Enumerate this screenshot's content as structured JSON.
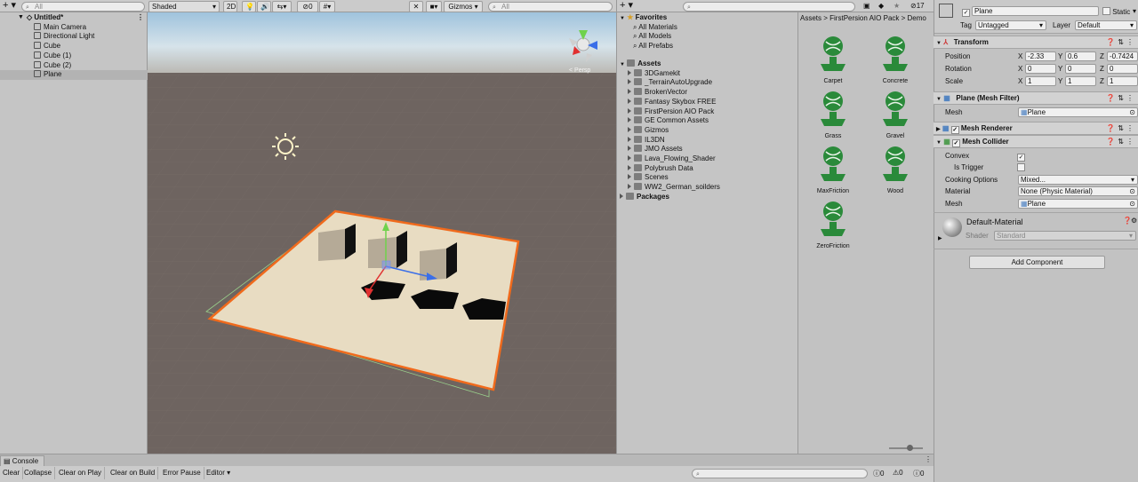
{
  "hierarchy": {
    "search_placeholder": "All",
    "scene": "Untitled*",
    "items": [
      "Main Camera",
      "Directional Light",
      "Cube",
      "Cube (1)",
      "Cube (2)",
      "Plane"
    ]
  },
  "scene_toolbar": {
    "shading": "Shaded",
    "mode_2d": "2D",
    "hidden_count": "0",
    "gizmos": "Gizmos",
    "search_placeholder": "All",
    "persp": "< Persp"
  },
  "project": {
    "favorites": "Favorites",
    "fav_items": [
      "All Materials",
      "All Models",
      "All Prefabs"
    ],
    "assets": "Assets",
    "folders": [
      "3DGamekit",
      "_TerrainAutoUpgrade",
      "BrokenVector",
      "Fantasy Skybox FREE",
      "FirstPersion AIO Pack",
      "GE Common Assets",
      "Gizmos",
      "IL3DN",
      "JMO Assets",
      "Lava_Flowing_Shader",
      "Polybrush Data",
      "Scenes",
      "WW2_German_soilders"
    ],
    "packages": "Packages",
    "hidden_count": "17",
    "breadcrumb": [
      "Assets",
      "FirstPersion AIO Pack",
      "Demo"
    ],
    "grid_assets": [
      "Carpet",
      "Concrete",
      "Grass",
      "Gravel",
      "MaxFriction",
      "Wood",
      "ZeroFriction"
    ]
  },
  "inspector": {
    "name": "Plane",
    "static_label": "Static",
    "tag_label": "Tag",
    "tag_value": "Untagged",
    "layer_label": "Layer",
    "layer_value": "Default",
    "transform": {
      "title": "Transform",
      "position": "Position",
      "rotation": "Rotation",
      "scale": "Scale",
      "pos": [
        "-2.33",
        "0.6",
        "-0.7424"
      ],
      "rot": [
        "0",
        "0",
        "0"
      ],
      "scl": [
        "1",
        "1",
        "1"
      ]
    },
    "mesh_filter": {
      "title": "Plane (Mesh Filter)",
      "mesh_label": "Mesh",
      "mesh_value": "Plane"
    },
    "mesh_renderer": {
      "title": "Mesh Renderer"
    },
    "mesh_collider": {
      "title": "Mesh Collider",
      "convex": "Convex",
      "is_trigger": "Is Trigger",
      "cooking": "Cooking Options",
      "cooking_value": "Mixed...",
      "material": "Material",
      "material_value": "None (Physic Material)",
      "mesh_label": "Mesh",
      "mesh_value": "Plane"
    },
    "material": {
      "name": "Default-Material",
      "shader_label": "Shader",
      "shader_value": "Standard"
    },
    "add_component": "Add Component"
  },
  "console": {
    "tab": "Console",
    "buttons": [
      "Clear",
      "Collapse",
      "Clear on Play",
      "Clear on Build",
      "Error Pause",
      "Editor"
    ],
    "counts": [
      "0",
      "0",
      "0"
    ]
  },
  "axis_labels": [
    "X",
    "Y",
    "Z"
  ]
}
